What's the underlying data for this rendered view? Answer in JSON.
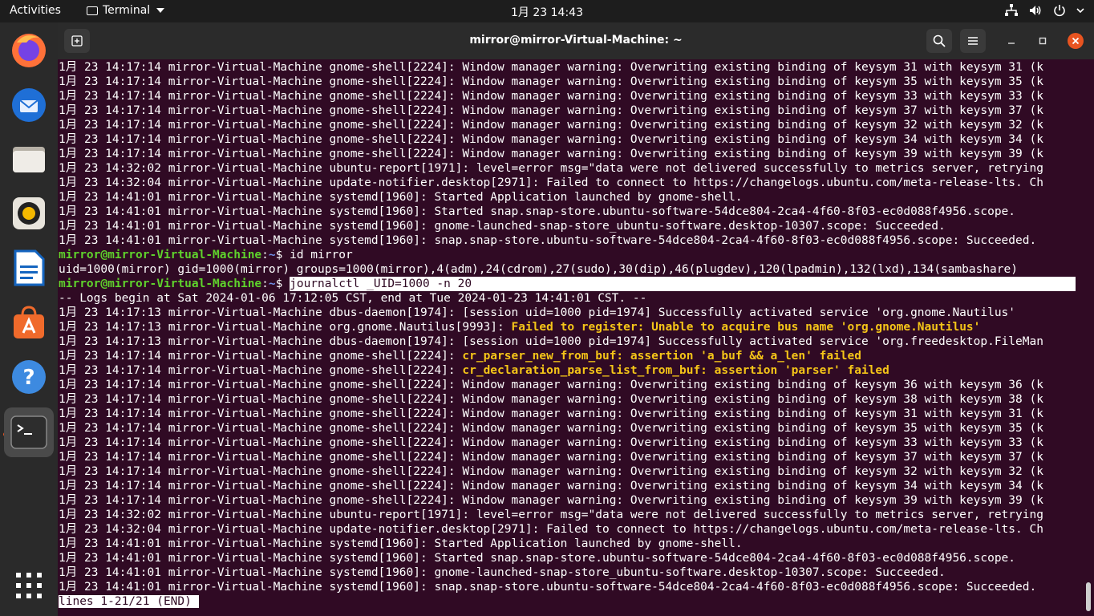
{
  "topbar": {
    "activities": "Activities",
    "app_name": "Terminal",
    "clock": "1月 23  14:43"
  },
  "dock": {
    "items": [
      {
        "name": "firefox-icon"
      },
      {
        "name": "thunderbird-icon"
      },
      {
        "name": "files-icon"
      },
      {
        "name": "rhythmbox-icon"
      },
      {
        "name": "writer-icon"
      },
      {
        "name": "software-icon"
      },
      {
        "name": "help-icon"
      },
      {
        "name": "terminal-icon"
      }
    ]
  },
  "window": {
    "title": "mirror@mirror-Virtual-Machine: ~"
  },
  "colors": {
    "terminal_bg": "#300a24",
    "prompt_green": "#5fd22c",
    "path_blue": "#6f8fe6",
    "warning_yellow": "#f5c518",
    "close_orange": "#e95420"
  },
  "terminal": {
    "prompt_user": "mirror@mirror-Virtual-Machine",
    "prompt_path": "~",
    "prompt_sigil": "$",
    "lines": [
      "1月 23 14:17:14 mirror-Virtual-Machine gnome-shell[2224]: Window manager warning: Overwriting existing binding of keysym 31 with keysym 31 (k",
      "1月 23 14:17:14 mirror-Virtual-Machine gnome-shell[2224]: Window manager warning: Overwriting existing binding of keysym 35 with keysym 35 (k",
      "1月 23 14:17:14 mirror-Virtual-Machine gnome-shell[2224]: Window manager warning: Overwriting existing binding of keysym 33 with keysym 33 (k",
      "1月 23 14:17:14 mirror-Virtual-Machine gnome-shell[2224]: Window manager warning: Overwriting existing binding of keysym 37 with keysym 37 (k",
      "1月 23 14:17:14 mirror-Virtual-Machine gnome-shell[2224]: Window manager warning: Overwriting existing binding of keysym 32 with keysym 32 (k",
      "1月 23 14:17:14 mirror-Virtual-Machine gnome-shell[2224]: Window manager warning: Overwriting existing binding of keysym 34 with keysym 34 (k",
      "1月 23 14:17:14 mirror-Virtual-Machine gnome-shell[2224]: Window manager warning: Overwriting existing binding of keysym 39 with keysym 39 (k",
      "1月 23 14:32:02 mirror-Virtual-Machine ubuntu-report[1971]: level=error msg=\"data were not delivered successfully to metrics server, retrying",
      "1月 23 14:32:04 mirror-Virtual-Machine update-notifier.desktop[2971]: Failed to connect to https://changelogs.ubuntu.com/meta-release-lts. Ch",
      "1月 23 14:41:01 mirror-Virtual-Machine systemd[1960]: Started Application launched by gnome-shell.",
      "1月 23 14:41:01 mirror-Virtual-Machine systemd[1960]: Started snap.snap-store.ubuntu-software-54dce804-2ca4-4f60-8f03-ec0d088f4956.scope.",
      "1月 23 14:41:01 mirror-Virtual-Machine systemd[1960]: gnome-launched-snap-store_ubuntu-software.desktop-10307.scope: Succeeded.",
      "1月 23 14:41:01 mirror-Virtual-Machine systemd[1960]: snap.snap-store.ubuntu-software-54dce804-2ca4-4f60-8f03-ec0d088f4956.scope: Succeeded."
    ],
    "cmd1": "id mirror",
    "cmd1_output": "uid=1000(mirror) gid=1000(mirror) groups=1000(mirror),4(adm),24(cdrom),27(sudo),30(dip),46(plugdev),120(lpadmin),132(lxd),134(sambashare)",
    "cmd2": "journalctl _UID=1000 -n 20",
    "logs_begin": "-- Logs begin at Sat 2024-01-06 17:12:05 CST, end at Tue 2024-01-23 14:41:01 CST. --",
    "log2_a": "1月 23 14:17:13 mirror-Virtual-Machine dbus-daemon[1974]: [session uid=1000 pid=1974] Successfully activated service 'org.gnome.Nautilus'",
    "log2_b_prefix": "1月 23 14:17:13 mirror-Virtual-Machine org.gnome.Nautilus[9993]: ",
    "log2_b_msg": "Failed to register: Unable to acquire bus name 'org.gnome.Nautilus'",
    "log2_c": "1月 23 14:17:13 mirror-Virtual-Machine dbus-daemon[1974]: [session uid=1000 pid=1974] Successfully activated service 'org.freedesktop.FileMan",
    "log2_d_prefix": "1月 23 14:17:14 mirror-Virtual-Machine gnome-shell[2224]: ",
    "log2_d_msg": "cr_parser_new_from_buf: assertion 'a_buf && a_len' failed",
    "log2_e_prefix": "1月 23 14:17:14 mirror-Virtual-Machine gnome-shell[2224]: ",
    "log2_e_msg": "cr_declaration_parse_list_from_buf: assertion 'parser' failed",
    "lines2": [
      "1月 23 14:17:14 mirror-Virtual-Machine gnome-shell[2224]: Window manager warning: Overwriting existing binding of keysym 36 with keysym 36 (k",
      "1月 23 14:17:14 mirror-Virtual-Machine gnome-shell[2224]: Window manager warning: Overwriting existing binding of keysym 38 with keysym 38 (k",
      "1月 23 14:17:14 mirror-Virtual-Machine gnome-shell[2224]: Window manager warning: Overwriting existing binding of keysym 31 with keysym 31 (k",
      "1月 23 14:17:14 mirror-Virtual-Machine gnome-shell[2224]: Window manager warning: Overwriting existing binding of keysym 35 with keysym 35 (k",
      "1月 23 14:17:14 mirror-Virtual-Machine gnome-shell[2224]: Window manager warning: Overwriting existing binding of keysym 33 with keysym 33 (k",
      "1月 23 14:17:14 mirror-Virtual-Machine gnome-shell[2224]: Window manager warning: Overwriting existing binding of keysym 37 with keysym 37 (k",
      "1月 23 14:17:14 mirror-Virtual-Machine gnome-shell[2224]: Window manager warning: Overwriting existing binding of keysym 32 with keysym 32 (k",
      "1月 23 14:17:14 mirror-Virtual-Machine gnome-shell[2224]: Window manager warning: Overwriting existing binding of keysym 34 with keysym 34 (k",
      "1月 23 14:17:14 mirror-Virtual-Machine gnome-shell[2224]: Window manager warning: Overwriting existing binding of keysym 39 with keysym 39 (k",
      "1月 23 14:32:02 mirror-Virtual-Machine ubuntu-report[1971]: level=error msg=\"data were not delivered successfully to metrics server, retrying",
      "1月 23 14:32:04 mirror-Virtual-Machine update-notifier.desktop[2971]: Failed to connect to https://changelogs.ubuntu.com/meta-release-lts. Ch",
      "1月 23 14:41:01 mirror-Virtual-Machine systemd[1960]: Started Application launched by gnome-shell.",
      "1月 23 14:41:01 mirror-Virtual-Machine systemd[1960]: Started snap.snap-store.ubuntu-software-54dce804-2ca4-4f60-8f03-ec0d088f4956.scope.",
      "1月 23 14:41:01 mirror-Virtual-Machine systemd[1960]: gnome-launched-snap-store_ubuntu-software.desktop-10307.scope: Succeeded.",
      "1月 23 14:41:01 mirror-Virtual-Machine systemd[1960]: snap.snap-store.ubuntu-software-54dce804-2ca4-4f60-8f03-ec0d088f4956.scope: Succeeded."
    ],
    "pager_status": "lines 1-21/21 (END)"
  }
}
